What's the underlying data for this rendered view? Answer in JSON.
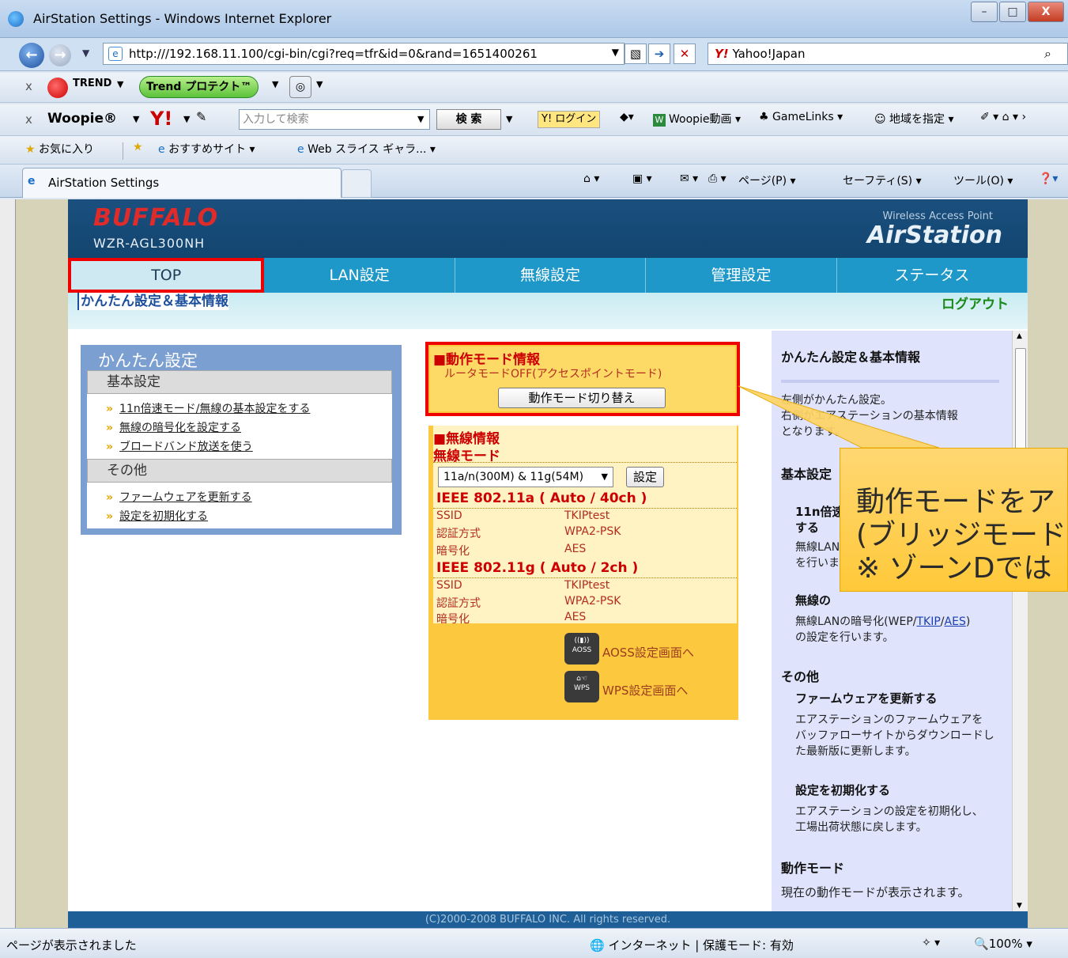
{
  "window": {
    "title": "AirStation Settings - Windows Internet Explorer",
    "minimize": "–",
    "maximize": "□",
    "close": "X"
  },
  "address_bar": {
    "url": "http:///192.168.11.100/cgi-bin/cgi?req=tfr&id=0&rand=1651400261",
    "search_provider_mark": "Y!",
    "search_provider": "Yahoo!Japan"
  },
  "toolbar1": {
    "trend_label": "TREND",
    "trend_protect": "Trend プロテクト™"
  },
  "toolbar2": {
    "woopie": "Woopie®",
    "yahoo_logo": "Y!",
    "search_placeholder": "入力して検索",
    "search_button": "検 索",
    "login": "Y! ログイン",
    "woopie_video": "Woopie動画",
    "gamelinks": "GameLinks",
    "region": "地域を指定"
  },
  "favorites_bar": {
    "favorites": "お気に入り",
    "suggested": "おすすめサイト",
    "webslice": "Web スライス ギャラ..."
  },
  "tab": {
    "active_title": "AirStation Settings",
    "page_menu": "ページ(P)",
    "safety_menu": "セーフティ(S)",
    "tools_menu": "ツール(O)"
  },
  "router": {
    "brand": "BUFFALO",
    "model": "WZR-AGL300NH",
    "product_tag": "Wireless Access Point",
    "product_name": "AirStation",
    "nav": [
      "TOP",
      "LAN設定",
      "無線設定",
      "管理設定",
      "ステータス"
    ],
    "subnav_current": "かんたん設定＆基本情報",
    "logout": "ログアウト",
    "footer": "(C)2000-2008 BUFFALO INC. All rights reserved."
  },
  "easy_setup": {
    "title": "かんたん設定",
    "basic_heading": "基本設定",
    "basic_links": [
      "11n倍速モード/無線の基本設定をする",
      "無線の暗号化を設定する",
      "ブロードバンド放送を使う"
    ],
    "other_heading": "その他",
    "other_links": [
      "ファームウェアを更新する",
      "設定を初期化する"
    ]
  },
  "mode_info": {
    "heading": "■動作モード情報",
    "status": "ルータモードOFF(アクセスポイントモード)",
    "switch_button": "動作モード切り替え"
  },
  "wireless_info": {
    "heading": "■無線情報",
    "mode_label": "無線モード",
    "mode_value": "11a/n(300M) & 11g(54M)",
    "set_button": "設定",
    "band_a": {
      "title": "IEEE 802.11a ( Auto / 40ch )",
      "ssid_label": "SSID",
      "ssid": "TKIPtest",
      "auth_label": "認証方式",
      "auth": "WPA2-PSK",
      "enc_label": "暗号化",
      "enc": "AES"
    },
    "band_g": {
      "title": "IEEE 802.11g ( Auto / 2ch )",
      "ssid_label": "SSID",
      "ssid": "TKIPtest",
      "auth_label": "認証方式",
      "auth": "WPA2-PSK",
      "enc_label": "暗号化",
      "enc": "AES"
    },
    "aoss_icon_text": "AOSS",
    "aoss_label": "AOSS設定画面へ",
    "wps_icon_text": "WPS",
    "wps_label": "WPS設定画面へ"
  },
  "help": {
    "title": "かんたん設定＆基本情報",
    "intro_1": "左側がかんたん設定。",
    "intro_2": "右側がエアステーションの基本情報",
    "intro_3": "となります。",
    "basic_heading": "基本設定",
    "fast_mode_title_1": "11n倍速",
    "fast_mode_title_2": "する",
    "fast_mode_text_1": "無線LAN",
    "fast_mode_text_2": "を行いま",
    "encryption_title": "無線の",
    "encryption_text_prefix": "無線LANの暗号化(WEP/",
    "encryption_tkip": "TKIP",
    "encryption_slash": "/",
    "encryption_aes": "AES",
    "encryption_text_suffix": ")",
    "encryption_text_2": "の設定を行います。",
    "other_heading": "その他",
    "firmware_title": "ファームウェアを更新する",
    "firmware_text_1": "エアステーションのファームウェアを",
    "firmware_text_2": "バッファローサイトからダウンロードし",
    "firmware_text_3": "た最新版に更新します。",
    "reset_title": "設定を初期化する",
    "reset_text_1": "エアステーションの設定を初期化し、",
    "reset_text_2": "工場出荷状態に戻します。",
    "mode_heading": "動作モード",
    "mode_text": "現在の動作モードが表示されます。"
  },
  "callout": {
    "line1": "動作モードをア",
    "line2": "(ブリッジモード",
    "line3": "※ ゾーンDでは"
  },
  "status_bar": {
    "text": "ページが表示されました",
    "zone": "インターネット | 保護モード: 有効",
    "zoom": "100%"
  },
  "colors": {
    "banner": "#12456f",
    "nav": "#1d98c8",
    "highlight_border": "#e00000",
    "mode_panel": "#fcc93e",
    "help_panel": "#dfe3fb",
    "callout": "#ffc93a"
  }
}
